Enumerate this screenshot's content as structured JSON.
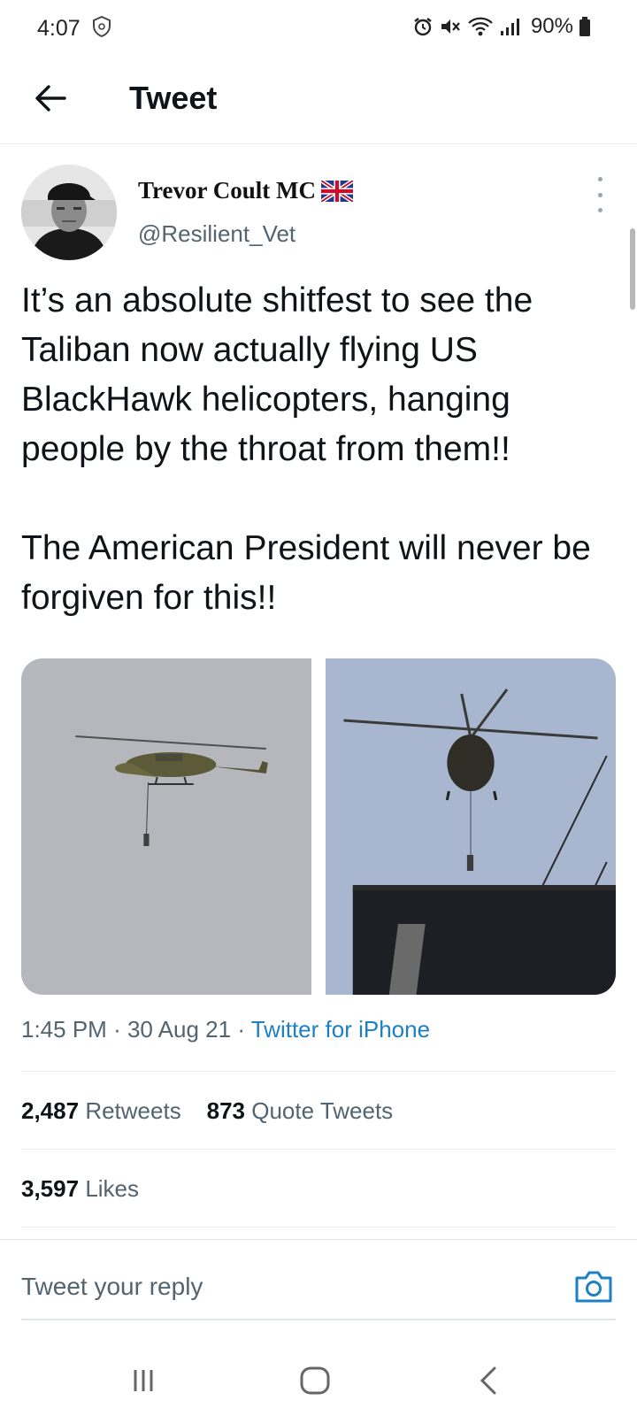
{
  "status_bar": {
    "time": "4:07",
    "battery": "90%"
  },
  "header": {
    "title": "Tweet"
  },
  "tweet": {
    "author_name": "Trevor Coult MC",
    "author_handle": "@Resilient_Vet",
    "text": "It’s an absolute shitfest to see the Taliban now actually flying US BlackHawk helicopters, hanging people by the throat from them!!\n\nThe American President will never be forgiven for this!!",
    "time": "1:45 PM",
    "date": "30 Aug 21",
    "source": "Twitter for iPhone",
    "retweets_count": "2,487",
    "retweets_label": "Retweets",
    "quotes_count": "873",
    "quotes_label": "Quote Tweets",
    "likes_count": "3,597",
    "likes_label": "Likes"
  },
  "reply": {
    "placeholder": "Tweet your reply"
  },
  "colors": {
    "link": "#1d7fc4",
    "secondary_text": "#536471",
    "primary_text": "#0f1419"
  },
  "icons": {
    "back": "arrow-left-icon",
    "more": "more-vertical-icon",
    "camera": "camera-icon",
    "flag": "uk-flag-icon"
  }
}
